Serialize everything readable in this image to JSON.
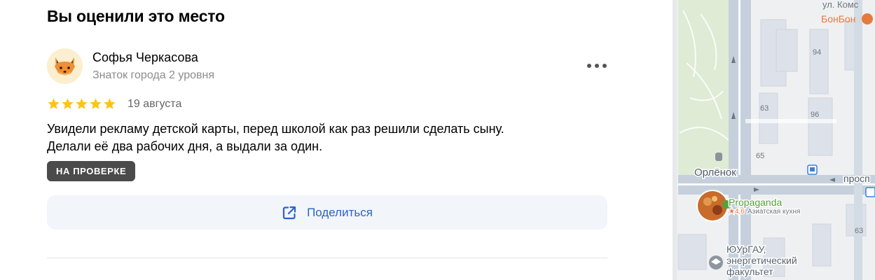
{
  "section": {
    "title": "Вы оценили это место"
  },
  "review": {
    "author": {
      "name": "Софья Черкасова",
      "level": "Знаток города 2 уровня",
      "avatar_icon": "fox-face-icon"
    },
    "rating": 5,
    "rating_max": 5,
    "date": "19 августа",
    "text_lines": [
      "Увидели рекламу детской карты, перед школой как раз решили сделать сыну.",
      "Делали её два рабочих дня, а выдали за один."
    ],
    "status_badge": "НА ПРОВЕРКЕ",
    "share_label": "Поделиться",
    "share_icon": "external-link-icon",
    "more_icon": "more-dots-icon"
  },
  "map": {
    "street_top": "ул. Комс",
    "poi_top": "БонБон",
    "house_numbers": {
      "n94": "94",
      "n63a": "63",
      "n96": "96",
      "n65": "65",
      "n63b": "63"
    },
    "landmark": "Орлёнок",
    "avenue": "просп",
    "restaurant": {
      "name": "Propaganda",
      "rating": "★4,6",
      "cuisine": "Азиатская кухня"
    },
    "university_lines": [
      "ЮУрГАУ,",
      "энергетический",
      "факультет"
    ],
    "colors": {
      "background": "#eff0f2",
      "road": "#c5d0dc",
      "park": "#dfebd5",
      "building": "#dde2ea",
      "poi_orange": "#e8793c",
      "restaurant_green": "#56a03c"
    }
  },
  "colors": {
    "star": "#fcc419",
    "badge_bg": "#4b4b4b",
    "share_bg": "#f2f5fa",
    "share_text": "#2a64c8"
  }
}
